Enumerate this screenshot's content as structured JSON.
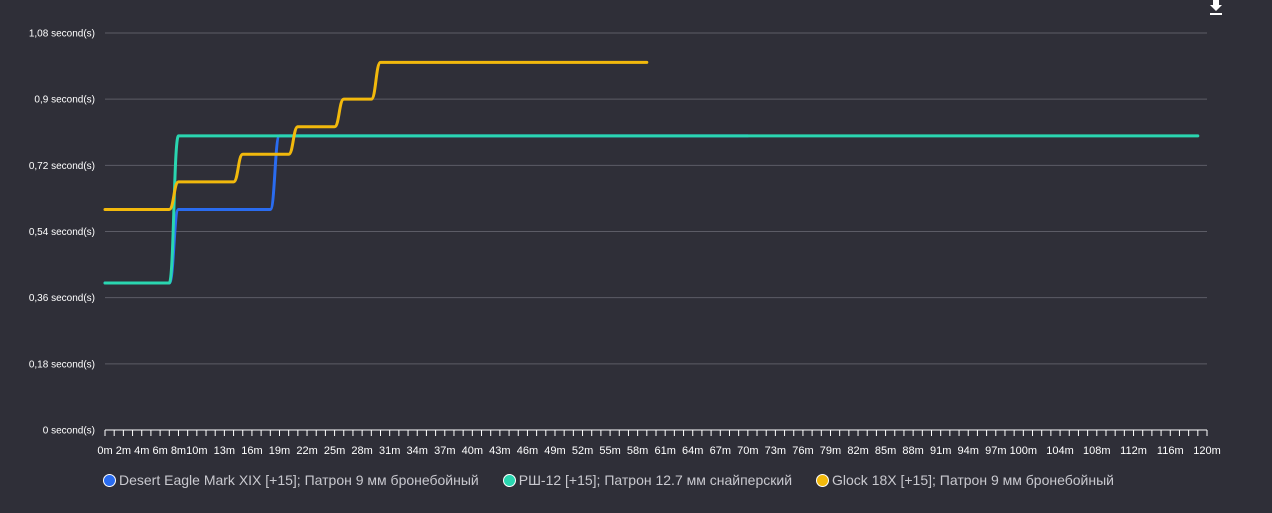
{
  "chart_data": {
    "type": "line",
    "title": "",
    "xlabel": "",
    "ylabel": "",
    "xlim": [
      0,
      120
    ],
    "ylim": [
      0,
      1.08
    ],
    "y_ticks": [
      {
        "value": 0,
        "label": "0 second(s)"
      },
      {
        "value": 0.18,
        "label": "0,18 second(s)"
      },
      {
        "value": 0.36,
        "label": "0,36 second(s)"
      },
      {
        "value": 0.54,
        "label": "0,54 second(s)"
      },
      {
        "value": 0.72,
        "label": "0,72 second(s)"
      },
      {
        "value": 0.9,
        "label": "0,9 second(s)"
      },
      {
        "value": 1.08,
        "label": "1,08 second(s)"
      }
    ],
    "x_ticks": [
      {
        "value": 0,
        "label": "0m"
      },
      {
        "value": 2,
        "label": "2m"
      },
      {
        "value": 4,
        "label": "4m"
      },
      {
        "value": 6,
        "label": "6m"
      },
      {
        "value": 8,
        "label": "8m"
      },
      {
        "value": 10,
        "label": "10m"
      },
      {
        "value": 13,
        "label": "13m"
      },
      {
        "value": 16,
        "label": "16m"
      },
      {
        "value": 19,
        "label": "19m"
      },
      {
        "value": 22,
        "label": "22m"
      },
      {
        "value": 25,
        "label": "25m"
      },
      {
        "value": 28,
        "label": "28m"
      },
      {
        "value": 31,
        "label": "31m"
      },
      {
        "value": 34,
        "label": "34m"
      },
      {
        "value": 37,
        "label": "37m"
      },
      {
        "value": 40,
        "label": "40m"
      },
      {
        "value": 43,
        "label": "43m"
      },
      {
        "value": 46,
        "label": "46m"
      },
      {
        "value": 49,
        "label": "49m"
      },
      {
        "value": 52,
        "label": "52m"
      },
      {
        "value": 55,
        "label": "55m"
      },
      {
        "value": 58,
        "label": "58m"
      },
      {
        "value": 61,
        "label": "61m"
      },
      {
        "value": 64,
        "label": "64m"
      },
      {
        "value": 67,
        "label": "67m"
      },
      {
        "value": 70,
        "label": "70m"
      },
      {
        "value": 73,
        "label": "73m"
      },
      {
        "value": 76,
        "label": "76m"
      },
      {
        "value": 79,
        "label": "79m"
      },
      {
        "value": 82,
        "label": "82m"
      },
      {
        "value": 85,
        "label": "85m"
      },
      {
        "value": 88,
        "label": "88m"
      },
      {
        "value": 91,
        "label": "91m"
      },
      {
        "value": 94,
        "label": "94m"
      },
      {
        "value": 97,
        "label": "97m"
      },
      {
        "value": 100,
        "label": "100m"
      },
      {
        "value": 104,
        "label": "104m"
      },
      {
        "value": 108,
        "label": "108m"
      },
      {
        "value": 112,
        "label": "112m"
      },
      {
        "value": 116,
        "label": "116m"
      },
      {
        "value": 120,
        "label": "120m"
      }
    ],
    "grid": true,
    "legend_position": "bottom-left",
    "series": [
      {
        "name": "Desert Eagle Mark XIX [+15]; Патрон 9 мм бронебойный",
        "color": "#2a6cf0",
        "points": [
          [
            0,
            0.4
          ],
          [
            7,
            0.4
          ],
          [
            8,
            0.6
          ],
          [
            18,
            0.6
          ],
          [
            19,
            0.8
          ],
          [
            70,
            0.8
          ]
        ]
      },
      {
        "name": "РШ-12 [+15]; Патрон 12.7 мм снайперский",
        "color": "#2ad6b0",
        "points": [
          [
            0,
            0.4
          ],
          [
            7,
            0.4
          ],
          [
            8,
            0.8
          ],
          [
            119,
            0.8
          ]
        ]
      },
      {
        "name": "Glock 18X [+15]; Патрон 9 мм бронебойный",
        "color": "#f2b90c",
        "points": [
          [
            0,
            0.6
          ],
          [
            7,
            0.6
          ],
          [
            8,
            0.675
          ],
          [
            14,
            0.675
          ],
          [
            15,
            0.75
          ],
          [
            20,
            0.75
          ],
          [
            21,
            0.825
          ],
          [
            25,
            0.825
          ],
          [
            26,
            0.9
          ],
          [
            29,
            0.9
          ],
          [
            30,
            1.0
          ],
          [
            59,
            1.0
          ]
        ]
      }
    ]
  },
  "toolbar": {
    "download_icon": "download-icon"
  }
}
